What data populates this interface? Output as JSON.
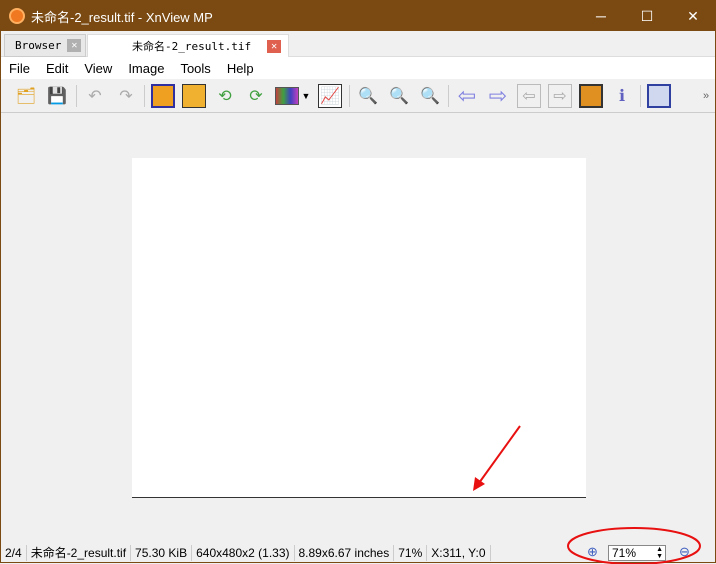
{
  "window": {
    "title": "未命名-2_result.tif - XnView MP",
    "controls": [
      "minimize",
      "maximize",
      "close"
    ]
  },
  "tabs": [
    {
      "label": "Browser"
    },
    {
      "label": "未命名-2_result.tif",
      "active": true
    }
  ],
  "menu": [
    "File",
    "Edit",
    "View",
    "Image",
    "Tools",
    "Help"
  ],
  "toolbar": [
    "folder-tree-icon",
    "save-icon",
    "undo-icon",
    "redo-icon",
    "crop-icon",
    "resize-icon",
    "rotate-left-icon",
    "rotate-right-icon",
    "adjust-colors-icon",
    "levels-icon",
    "zoom-in-icon",
    "zoom-1-1-icon",
    "zoom-out-icon",
    "previous-icon",
    "next-icon",
    "previous-page-icon",
    "next-page-icon",
    "slideshow-icon",
    "properties-icon",
    "fullscreen-icon"
  ],
  "toolbar_overflow": "»",
  "status": {
    "index": "2/4",
    "filename": "未命名-2_result.tif",
    "size": "75.30 KiB",
    "dims": "640x480x2 (1.33)",
    "print": "8.89x6.67 inches",
    "zoom": "71%",
    "coords": "X:311, Y:0"
  },
  "zoom_field": {
    "value": "71%"
  },
  "colors": {
    "titlebar": "#7a4a12",
    "annotation": "#e81010"
  }
}
